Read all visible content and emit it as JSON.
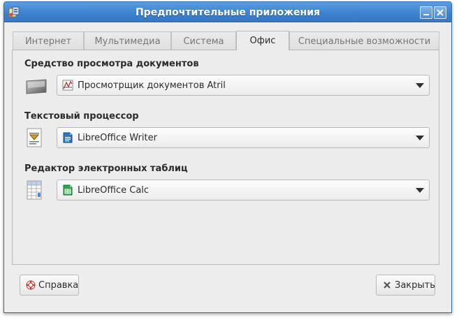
{
  "window": {
    "title": "Предпочтительные приложения",
    "app_icon": "preferred-apps-icon",
    "controls": [
      "minimize-icon",
      "close-icon"
    ]
  },
  "tabs": [
    {
      "label": "Интернет",
      "active": false
    },
    {
      "label": "Мультимедиа",
      "active": false
    },
    {
      "label": "Система",
      "active": false
    },
    {
      "label": "Офис",
      "active": true
    },
    {
      "label": "Специальные возможности",
      "active": false
    }
  ],
  "sections": [
    {
      "label": "Средство просмотра документов",
      "category_icon": "document-viewer-icon",
      "selected": "Просмотрщик документов Atril",
      "app_icon": "atril-icon"
    },
    {
      "label": "Текстовый процессор",
      "category_icon": "word-processor-icon",
      "selected": "LibreOffice Writer",
      "app_icon": "libreoffice-writer-icon"
    },
    {
      "label": "Редактор электронных таблиц",
      "category_icon": "spreadsheet-icon",
      "selected": "LibreOffice Calc",
      "app_icon": "libreoffice-calc-icon"
    }
  ],
  "buttons": {
    "help": {
      "label": "Справка",
      "icon": "help-lifebuoy-icon"
    },
    "close": {
      "label": "Закрыть",
      "icon": "close-x-icon"
    }
  },
  "colors": {
    "titlebar": "#3e82d0",
    "title_text": "#ffffff",
    "window_bg": "#ededed"
  }
}
